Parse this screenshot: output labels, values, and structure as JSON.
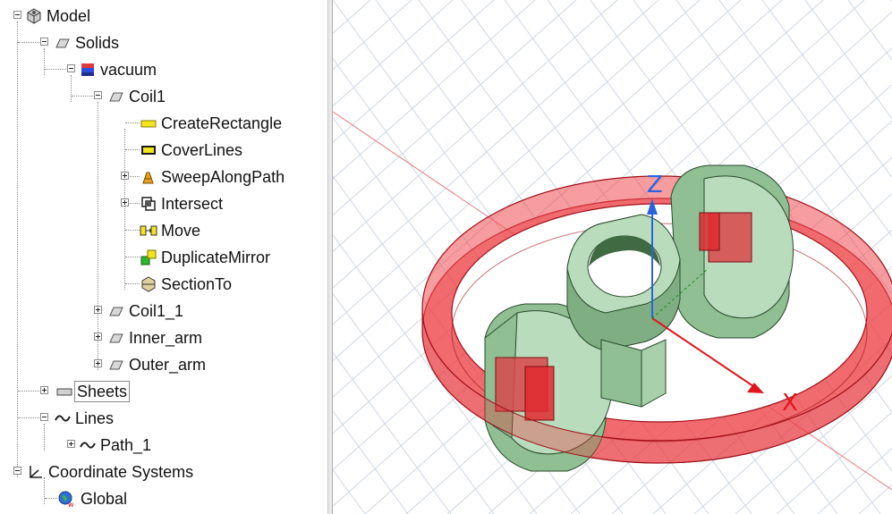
{
  "tree": {
    "items": [
      {
        "label": "Model",
        "icon": "model-icon"
      },
      {
        "label": "Solids",
        "icon": "solid-folder-icon"
      },
      {
        "label": "vacuum",
        "icon": "material-icon"
      },
      {
        "label": "Coil1",
        "icon": "solid-icon"
      },
      {
        "label": "CreateRectangle",
        "icon": "rectangle-icon"
      },
      {
        "label": "CoverLines",
        "icon": "cover-lines-icon"
      },
      {
        "label": "SweepAlongPath",
        "icon": "sweep-icon"
      },
      {
        "label": "Intersect",
        "icon": "intersect-icon"
      },
      {
        "label": "Move",
        "icon": "move-icon"
      },
      {
        "label": "DuplicateMirror",
        "icon": "duplicate-mirror-icon"
      },
      {
        "label": "SectionTo",
        "icon": "section-icon"
      },
      {
        "label": "Coil1_1",
        "icon": "solid-icon"
      },
      {
        "label": "Inner_arm",
        "icon": "solid-icon"
      },
      {
        "label": "Outer_arm",
        "icon": "solid-icon"
      },
      {
        "label": "Sheets",
        "icon": "sheet-icon"
      },
      {
        "label": "Lines",
        "icon": "line-icon"
      },
      {
        "label": "Path_1",
        "icon": "line-icon"
      },
      {
        "label": "Coordinate Systems",
        "icon": "coordinate-systems-icon"
      },
      {
        "label": "Global",
        "icon": "global-cs-icon"
      }
    ]
  },
  "viewport": {
    "axes": {
      "z_label": "Z",
      "x_label": "X"
    },
    "colors": {
      "coil": "#e8343a",
      "core": "#b9dcbc",
      "z_axis": "#2a63e0",
      "x_axis": "#e0161e",
      "grid": "#cfd6e2"
    }
  }
}
